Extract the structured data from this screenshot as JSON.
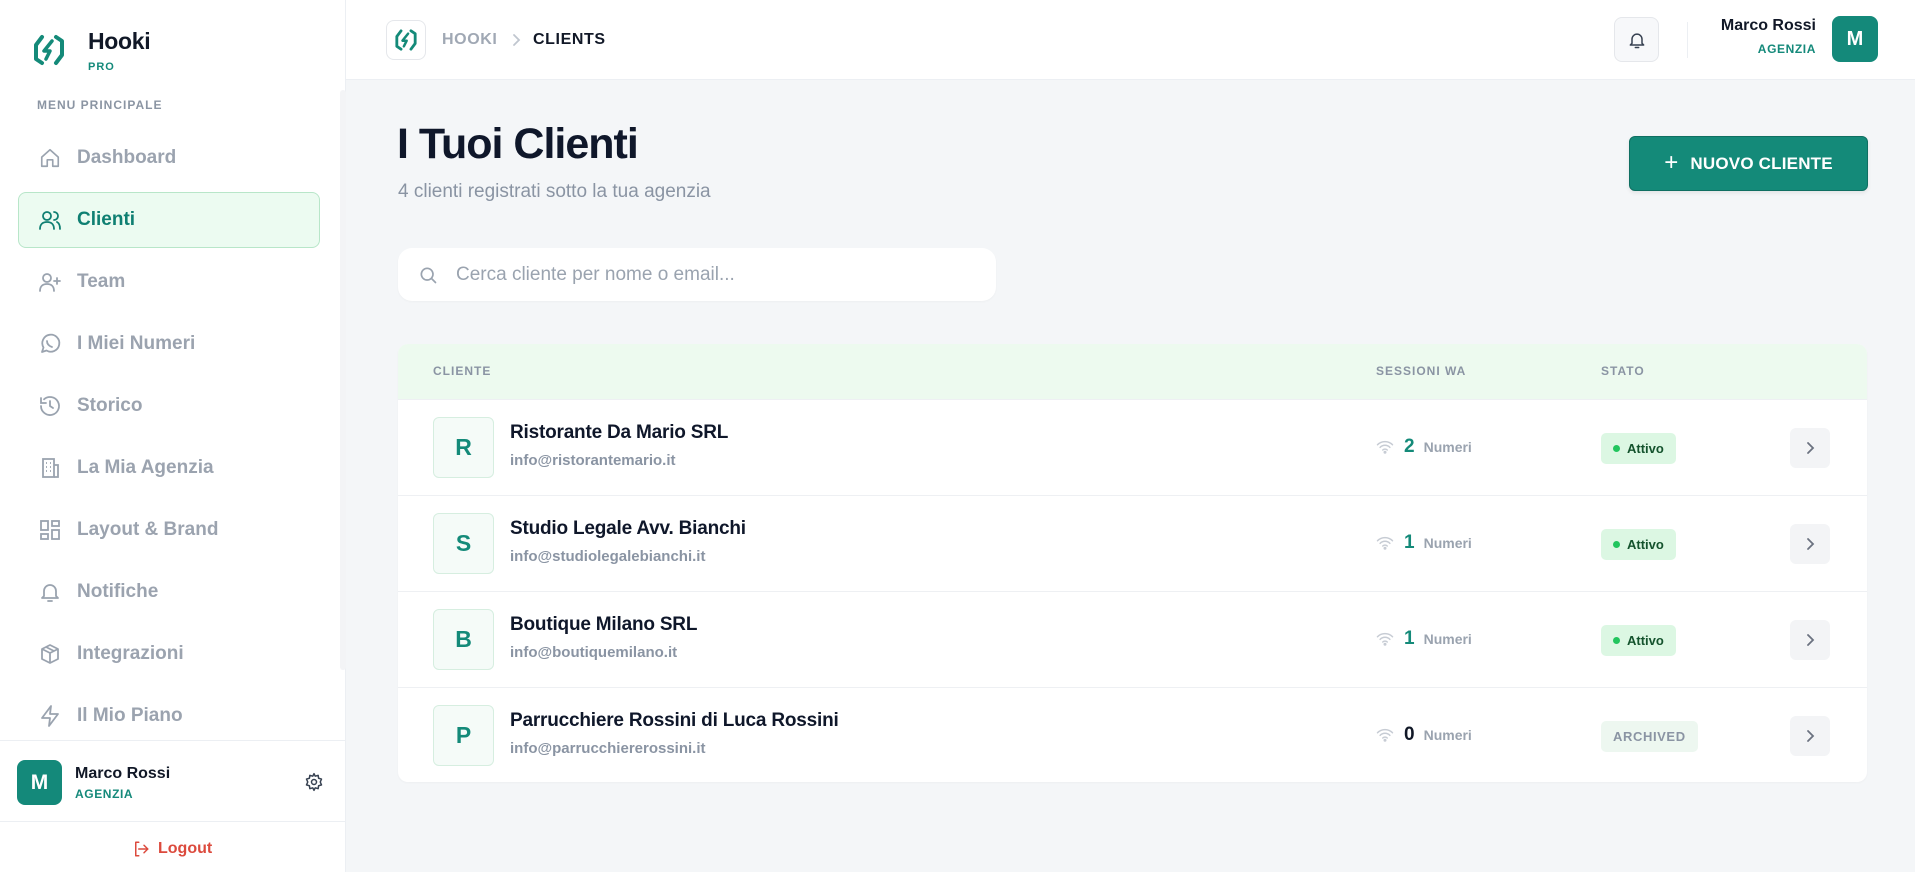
{
  "brand": {
    "name": "Hooki",
    "tier": "PRO"
  },
  "sidebar": {
    "menu_title": "MENU PRINCIPALE",
    "items": [
      {
        "label": "Dashboard",
        "icon": "home-icon"
      },
      {
        "label": "Clienti",
        "icon": "users-icon",
        "active": true
      },
      {
        "label": "Team",
        "icon": "user-plus-icon"
      },
      {
        "label": "I Miei Numeri",
        "icon": "whatsapp-icon"
      },
      {
        "label": "Storico",
        "icon": "history-icon"
      },
      {
        "label": "La Mia Agenzia",
        "icon": "building-icon"
      },
      {
        "label": "Layout & Brand",
        "icon": "layout-icon"
      },
      {
        "label": "Notifiche",
        "icon": "bell-icon"
      },
      {
        "label": "Integrazioni",
        "icon": "package-icon"
      },
      {
        "label": "Il Mio Piano",
        "icon": "zap-icon"
      }
    ],
    "user": {
      "initial": "M",
      "name": "Marco Rossi",
      "role": "AGENZIA"
    },
    "logout_label": "Logout"
  },
  "topbar": {
    "breadcrumb": [
      "HOOKI",
      "CLIENTS"
    ],
    "user": {
      "initial": "M",
      "name": "Marco Rossi",
      "role": "AGENZIA"
    }
  },
  "main": {
    "title": "I Tuoi Clienti",
    "subtitle": "4 clienti registrati sotto la tua agenzia",
    "new_button_label": "NUOVO CLIENTE",
    "search_placeholder": "Cerca cliente per nome o email..."
  },
  "table": {
    "headers": {
      "client": "CLIENTE",
      "sessions": "SESSIONI WA",
      "status": "STATO"
    },
    "rows": [
      {
        "initial": "R",
        "name": "Ristorante Da Mario SRL",
        "email": "info@ristorantemario.it",
        "sessions": "2",
        "unit": "Numeri",
        "status": "Attivo"
      },
      {
        "initial": "S",
        "name": "Studio Legale Avv. Bianchi",
        "email": "info@studiolegalebianchi.it",
        "sessions": "1",
        "unit": "Numeri",
        "status": "Attivo"
      },
      {
        "initial": "B",
        "name": "Boutique Milano SRL",
        "email": "info@boutiquemilano.it",
        "sessions": "1",
        "unit": "Numeri",
        "status": "Attivo"
      },
      {
        "initial": "P",
        "name": "Parrucchiere Rossini di Luca Rossini",
        "email": "info@parrucchiererossini.it",
        "sessions": "0",
        "unit": "Numeri",
        "status": "ARCHIVED"
      }
    ]
  },
  "colors": {
    "accent": "#148a79",
    "active_bg": "#ecfbf1",
    "danger": "#dc4a3d"
  }
}
